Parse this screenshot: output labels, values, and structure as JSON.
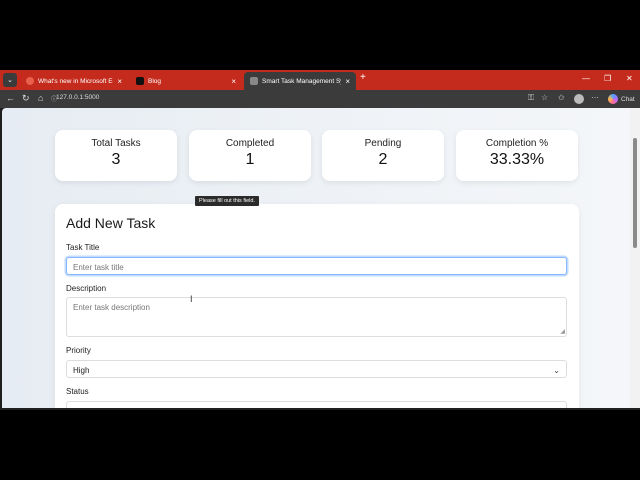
{
  "browser": {
    "tabs": [
      {
        "label": "What's new in Microsoft Edge"
      },
      {
        "label": "Blog"
      },
      {
        "label": "Smart Task Management System"
      }
    ],
    "address": "127.0.0.1:5000",
    "chat_label": "Chat",
    "accent": "#c42b1c"
  },
  "stats": [
    {
      "title": "Total Tasks",
      "value": "3"
    },
    {
      "title": "Completed",
      "value": "1"
    },
    {
      "title": "Pending",
      "value": "2"
    },
    {
      "title": "Completion %",
      "value": "33.33%"
    }
  ],
  "form": {
    "heading": "Add New Task",
    "title_label": "Task Title",
    "title_placeholder": "Enter task title",
    "tooltip": "Please fill out this field.",
    "description_label": "Description",
    "description_placeholder": "Enter task description",
    "priority_label": "Priority",
    "priority_value": "High",
    "status_label": "Status"
  }
}
